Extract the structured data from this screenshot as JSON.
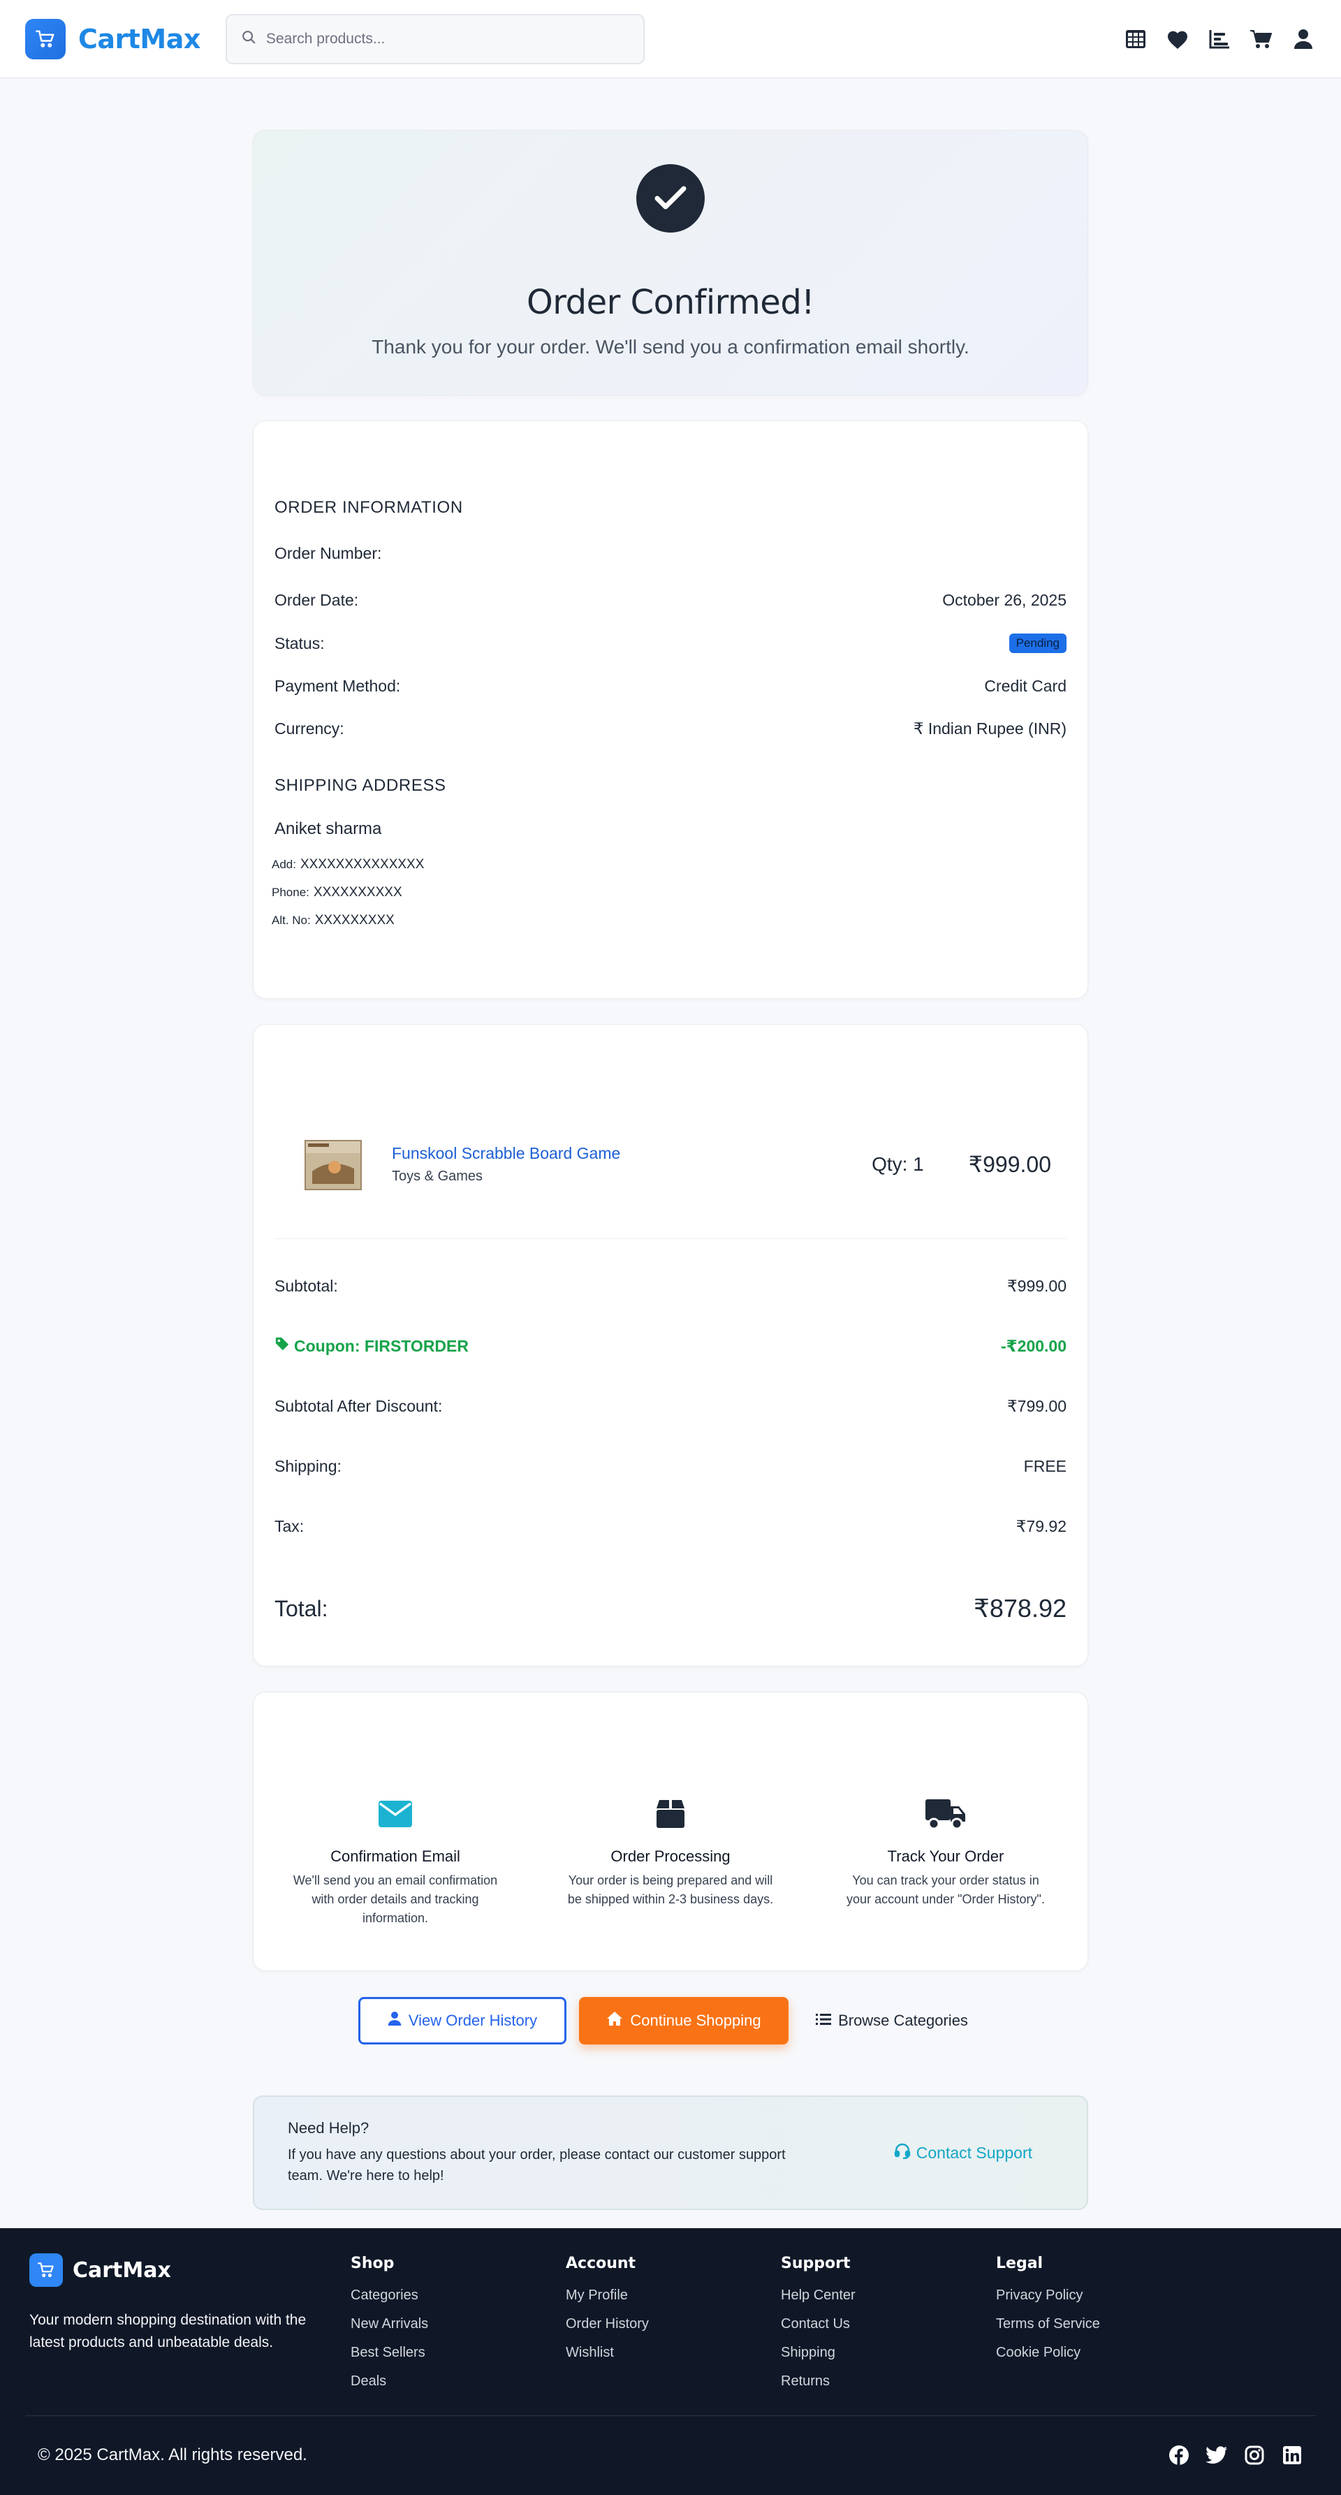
{
  "header": {
    "brand": "CartMax",
    "search_placeholder": "Search products...",
    "icons": [
      "grid-icon",
      "heart-icon",
      "chart-icon",
      "cart-icon",
      "user-icon"
    ]
  },
  "confirmation": {
    "title": "Order Confirmed!",
    "message": "Thank you for your order. We'll send you a confirmation email shortly."
  },
  "order_info": {
    "title": "ORDER INFORMATION",
    "rows": [
      {
        "label": "Order Number:",
        "value": ""
      },
      {
        "label": "Order Date:",
        "value": "October 26, 2025"
      },
      {
        "label": "Status:",
        "value": "Pending"
      },
      {
        "label": "Payment Method:",
        "value": "Credit Card"
      },
      {
        "label": "Currency:",
        "value": "₹ Indian Rupee (INR)"
      }
    ]
  },
  "shipping": {
    "title": "SHIPPING ADDRESS",
    "name": "Aniket sharma",
    "address_label": "Add:",
    "address": "XXXXXXXXXXXXXX",
    "phone_label": "Phone:",
    "phone": "XXXXXXXXXX",
    "alt_label": "Alt. No:",
    "alt": "XXXXXXXXX"
  },
  "item": {
    "name": "Funskool Scrabble Board Game",
    "category": "Toys & Games",
    "qty": "Qty: 1",
    "price": "₹999.00"
  },
  "totals": {
    "subtotal_label": "Subtotal:",
    "subtotal": "₹999.00",
    "coupon_label": "Coupon: FIRSTORDER",
    "coupon": "-₹200.00",
    "after_discount_label": "Subtotal After Discount:",
    "after_discount": "₹799.00",
    "shipping_label": "Shipping:",
    "shipping": "FREE",
    "tax_label": "Tax:",
    "tax": "₹79.92",
    "total_label": "Total:",
    "total": "₹878.92"
  },
  "steps": [
    {
      "title": "Confirmation Email",
      "desc": "We'll send you an email confirmation with order details and tracking information.",
      "icon": "envelope-icon"
    },
    {
      "title": "Order Processing",
      "desc": "Your order is being prepared and will be shipped within 2-3 business days.",
      "icon": "box-icon"
    },
    {
      "title": "Track Your Order",
      "desc": "You can track your order status in your account under \"Order History\".",
      "icon": "truck-icon"
    }
  ],
  "actions": {
    "history": "View Order History",
    "continue": "Continue Shopping",
    "browse": "Browse Categories"
  },
  "help": {
    "title": "Need Help?",
    "text": "If you have any questions about your order, please contact our customer support team. We're here to help!",
    "link": "Contact Support"
  },
  "footer": {
    "brand": "CartMax",
    "tagline": "Your modern shopping destination with the latest products and unbeatable deals.",
    "columns": [
      {
        "title": "Shop",
        "links": [
          "Categories",
          "New Arrivals",
          "Best Sellers",
          "Deals"
        ]
      },
      {
        "title": "Account",
        "links": [
          "My Profile",
          "Order History",
          "Wishlist"
        ]
      },
      {
        "title": "Support",
        "links": [
          "Help Center",
          "Contact Us",
          "Shipping",
          "Returns"
        ]
      },
      {
        "title": "Legal",
        "links": [
          "Privacy Policy",
          "Terms of Service",
          "Cookie Policy"
        ]
      }
    ],
    "copyright": "© 2025 CartMax. All rights reserved.",
    "socials": [
      "facebook-icon",
      "twitter-icon",
      "instagram-icon",
      "linkedin-icon"
    ]
  },
  "colors": {
    "brand": "#1e88e5",
    "primary": "#2563eb",
    "accent_orange": "#f97316",
    "success": "#16a34a",
    "footer_bg": "#101828"
  }
}
